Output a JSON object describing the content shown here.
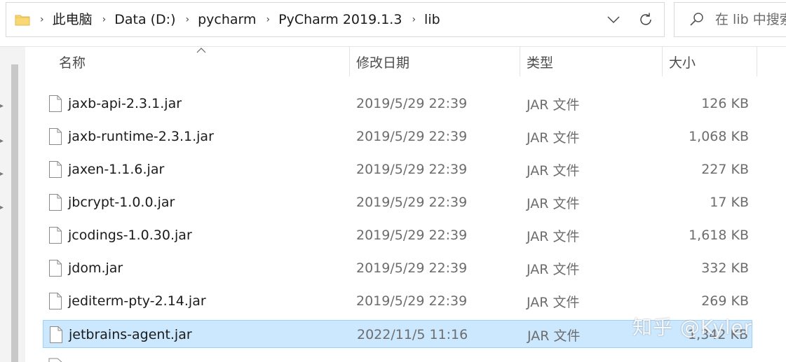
{
  "address_bar": {
    "folder_icon": "folder-icon",
    "crumbs": [
      "此电脑",
      "Data (D:)",
      "pycharm",
      "PyCharm 2019.1.3",
      "lib"
    ],
    "dropdown_icon": "chevron-down-icon",
    "refresh_icon": "refresh-icon"
  },
  "search": {
    "placeholder": "在 lib 中搜索",
    "icon": "search-icon"
  },
  "columns": {
    "name": "名称",
    "date": "修改日期",
    "type": "类型",
    "size": "大小"
  },
  "files": [
    {
      "name": "jaxb-api-2.3.1.jar",
      "date": "2019/5/29 22:39",
      "type": "JAR 文件",
      "size": "126 KB",
      "selected": false
    },
    {
      "name": "jaxb-runtime-2.3.1.jar",
      "date": "2019/5/29 22:39",
      "type": "JAR 文件",
      "size": "1,068 KB",
      "selected": false
    },
    {
      "name": "jaxen-1.1.6.jar",
      "date": "2019/5/29 22:39",
      "type": "JAR 文件",
      "size": "227 KB",
      "selected": false
    },
    {
      "name": "jbcrypt-1.0.0.jar",
      "date": "2019/5/29 22:39",
      "type": "JAR 文件",
      "size": "17 KB",
      "selected": false
    },
    {
      "name": "jcodings-1.0.30.jar",
      "date": "2019/5/29 22:39",
      "type": "JAR 文件",
      "size": "1,618 KB",
      "selected": false
    },
    {
      "name": "jdom.jar",
      "date": "2019/5/29 22:39",
      "type": "JAR 文件",
      "size": "332 KB",
      "selected": false
    },
    {
      "name": "jediterm-pty-2.14.jar",
      "date": "2019/5/29 22:39",
      "type": "JAR 文件",
      "size": "269 KB",
      "selected": false
    },
    {
      "name": "jetbrains-agent.jar",
      "date": "2022/11/5 11:16",
      "type": "JAR 文件",
      "size": "1,342 KB",
      "selected": true
    }
  ],
  "watermark": "知乎 @Kyler",
  "colors": {
    "selection_fill": "#cce8ff",
    "selection_border": "#99d1ff",
    "folder_yellow": "#f8d775"
  }
}
